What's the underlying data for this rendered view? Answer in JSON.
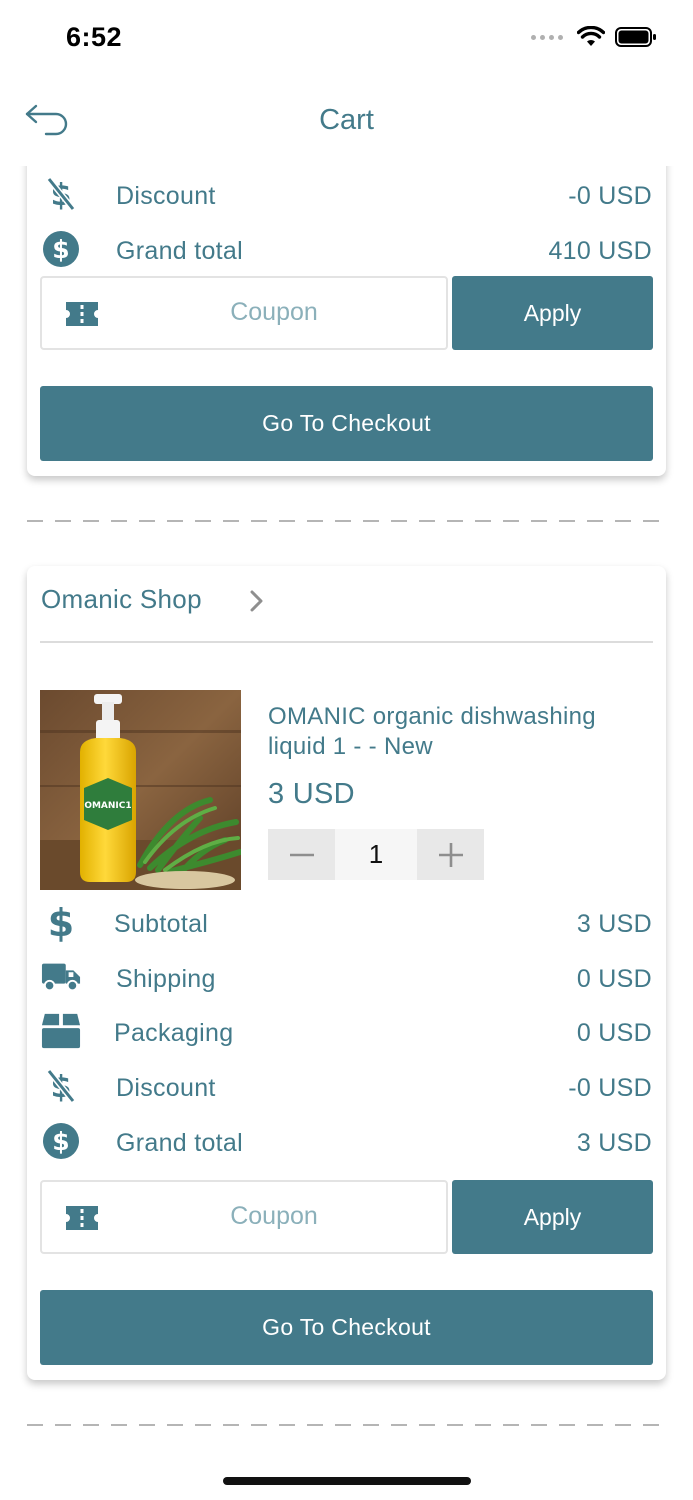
{
  "status_bar": {
    "time": "6:52"
  },
  "nav": {
    "title": "Cart"
  },
  "top_card": {
    "rows": [
      {
        "icon": "discount-icon",
        "label": "Discount",
        "value": "-0 USD"
      },
      {
        "icon": "dollar-circle-icon",
        "label": "Grand total",
        "value": "410 USD"
      }
    ],
    "coupon_placeholder": "Coupon",
    "apply_label": "Apply",
    "checkout_label": "Go To Checkout"
  },
  "shop_card": {
    "shop_name": "Omanic Shop",
    "product": {
      "title": "OMANIC organic dishwashing liquid 1 -  - New",
      "price": "3 USD",
      "quantity": "1",
      "label_text": "OMANIC1"
    },
    "rows": [
      {
        "icon": "dollar-icon",
        "label": "Subtotal",
        "value": "3 USD"
      },
      {
        "icon": "truck-icon",
        "label": "Shipping",
        "value": "0 USD"
      },
      {
        "icon": "box-icon",
        "label": "Packaging",
        "value": "0 USD"
      },
      {
        "icon": "discount-icon",
        "label": "Discount",
        "value": "-0 USD"
      },
      {
        "icon": "dollar-circle-icon",
        "label": "Grand total",
        "value": "3 USD"
      }
    ],
    "coupon_placeholder": "Coupon",
    "apply_label": "Apply",
    "checkout_label": "Go To Checkout"
  },
  "colors": {
    "accent": "#437a8a",
    "placeholder": "#8bb0ba",
    "border": "#e3e3e3"
  }
}
